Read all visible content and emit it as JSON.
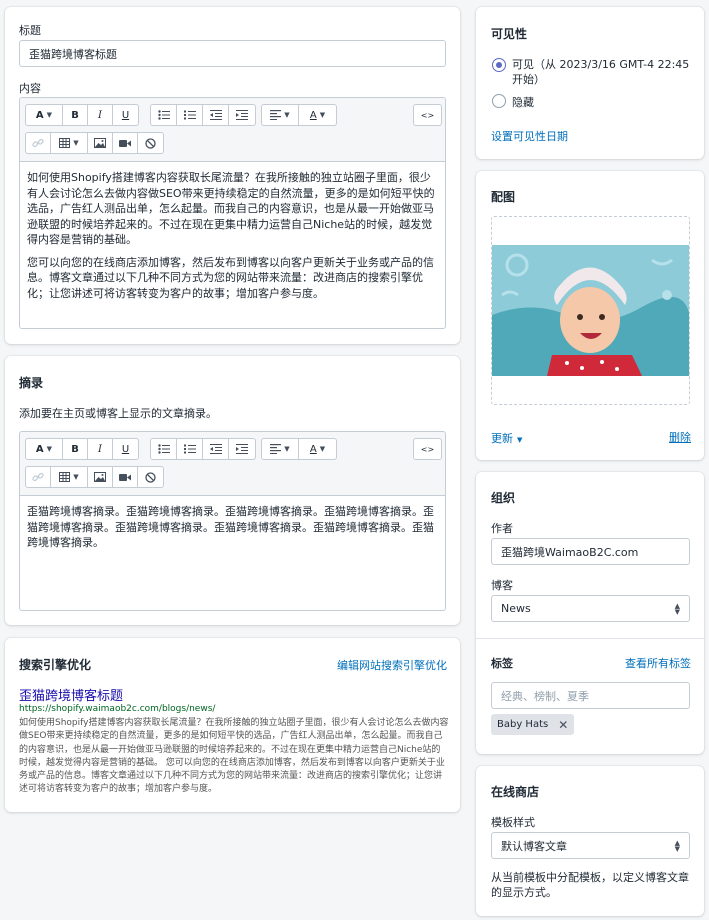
{
  "post": {
    "title_label": "标题",
    "title_value": "歪猫跨境博客标题",
    "content_label": "内容",
    "content_paragraphs": [
      "如何使用Shopify搭建博客内容获取长尾流量？在我所接触的独立站圈子里面，很少有人会讨论怎么去做内容做SEO带来更持续稳定的自然流量，更多的是如何短平快的选品，广告红人测品出单，怎么起量。而我自己的内容意识，也是从最一开始做亚马逊联盟的时候培养起来的。不过在现在更集中精力运营自己Niche站的时候，越发觉得内容是营销的基础。",
      "您可以向您的在线商店添加博客，然后发布到博客以向客户更新关于业务或产品的信息。博客文章通过以下几种不同方式为您的网站带来流量：改进商店的搜索引擎优化；让您讲述可将访客转变为客户的故事；增加客户参与度。"
    ]
  },
  "excerpt": {
    "title": "摘录",
    "description": "添加要在主页或博客上显示的文章摘录。",
    "text": "歪猫跨境博客摘录。歪猫跨境博客摘录。歪猫跨境博客摘录。歪猫跨境博客摘录。歪猫跨境博客摘录。歪猫跨境博客摘录。歪猫跨境博客摘录。歪猫跨境博客摘录。歪猫跨境博客摘录。"
  },
  "toolbar": {
    "font_icon": "A",
    "bold_icon": "B",
    "italic_icon": "I",
    "underline_icon": "U",
    "text_color_icon": "A",
    "html_icon": "<>"
  },
  "seo": {
    "title": "搜索引擎优化",
    "edit_link": "编辑网站搜索引擎优化",
    "preview_title": "歪猫跨境博客标题",
    "preview_url": "https://shopify.waimaob2c.com/blogs/news/",
    "preview_description": "如何使用Shopify搭建博客内容获取长尾流量？在我所接触的独立站圈子里面，很少有人会讨论怎么去做内容做SEO带来更持续稳定的自然流量，更多的是如何短平快的选品，广告红人测品出单，怎么起量。而我自己的内容意识，也是从最一开始做亚马逊联盟的时候培养起来的。不过在现在更集中精力运营自己Niche站的时候，越发觉得内容是营销的基础。 您可以向您的在线商店添加博客，然后发布到博客以向客户更新关于业务或产品的信息。博客文章通过以下几种不同方式为您的网站带来流量：改进商店的搜索引擎优化；让您讲述可将访客转变为客户的故事；增加客户参与度。"
  },
  "visibility": {
    "title": "可见性",
    "visible_label": "可见（从 2023/3/16 GMT-4 22:45 开始）",
    "hidden_label": "隐藏",
    "set_date_link": "设置可见性日期"
  },
  "image": {
    "title": "配图",
    "change_link": "更新",
    "delete_link": "删除"
  },
  "organization": {
    "title": "组织",
    "author_label": "作者",
    "author_value": "歪猫跨境WaimaoB2C.com",
    "blog_label": "博客",
    "blog_value": "News",
    "tags_label": "标签",
    "tags_link": "查看所有标签",
    "tags_placeholder": "经典、榜制、夏季",
    "tags": [
      "Baby Hats"
    ]
  },
  "store": {
    "title": "在线商店",
    "template_label": "模板样式",
    "template_value": "默认博客文章",
    "help": "从当前模板中分配模板，以定义博客文章的显示方式。"
  },
  "colors": {
    "accent": "#5c6ac4",
    "link": "#006fbb",
    "seo_title": "#1a0dab",
    "image_bg": "#8ecbd8"
  }
}
